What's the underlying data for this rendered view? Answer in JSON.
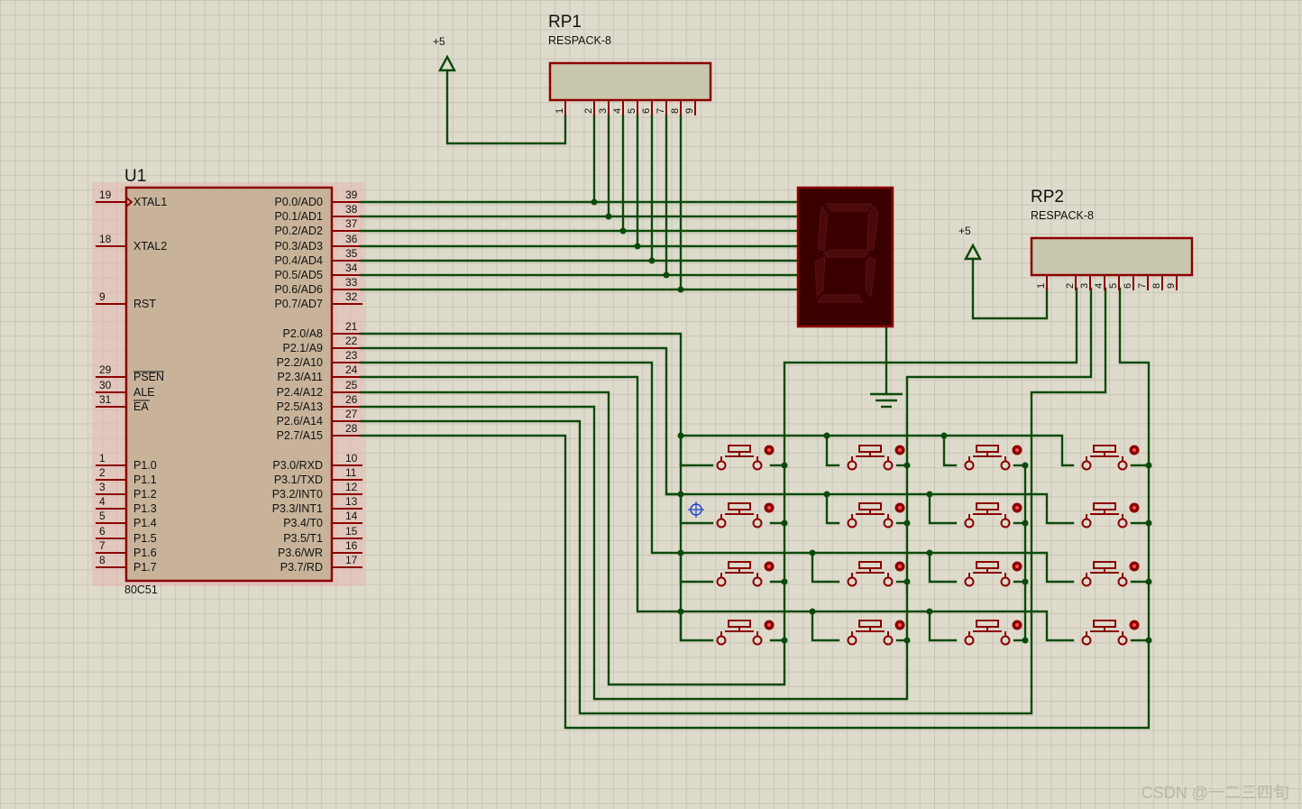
{
  "mcu": {
    "ref": "U1",
    "part": "80C51",
    "left_pins": [
      {
        "num": "19",
        "name": "XTAL1"
      },
      {
        "num": "18",
        "name": "XTAL2"
      },
      {
        "num": "9",
        "name": "RST"
      },
      {
        "num": "29",
        "name": "PSEN"
      },
      {
        "num": "30",
        "name": "ALE"
      },
      {
        "num": "31",
        "name": "EA"
      },
      {
        "num": "1",
        "name": "P1.0"
      },
      {
        "num": "2",
        "name": "P1.1"
      },
      {
        "num": "3",
        "name": "P1.2"
      },
      {
        "num": "4",
        "name": "P1.3"
      },
      {
        "num": "5",
        "name": "P1.4"
      },
      {
        "num": "6",
        "name": "P1.5"
      },
      {
        "num": "7",
        "name": "P1.6"
      },
      {
        "num": "8",
        "name": "P1.7"
      }
    ],
    "right_pins": [
      {
        "num": "39",
        "name": "P0.0/AD0"
      },
      {
        "num": "38",
        "name": "P0.1/AD1"
      },
      {
        "num": "37",
        "name": "P0.2/AD2"
      },
      {
        "num": "36",
        "name": "P0.3/AD3"
      },
      {
        "num": "35",
        "name": "P0.4/AD4"
      },
      {
        "num": "34",
        "name": "P0.5/AD5"
      },
      {
        "num": "33",
        "name": "P0.6/AD6"
      },
      {
        "num": "32",
        "name": "P0.7/AD7"
      },
      {
        "num": "21",
        "name": "P2.0/A8"
      },
      {
        "num": "22",
        "name": "P2.1/A9"
      },
      {
        "num": "23",
        "name": "P2.2/A10"
      },
      {
        "num": "24",
        "name": "P2.3/A11"
      },
      {
        "num": "25",
        "name": "P2.4/A12"
      },
      {
        "num": "26",
        "name": "P2.5/A13"
      },
      {
        "num": "27",
        "name": "P2.6/A14"
      },
      {
        "num": "28",
        "name": "P2.7/A15"
      },
      {
        "num": "10",
        "name": "P3.0/RXD"
      },
      {
        "num": "11",
        "name": "P3.1/TXD"
      },
      {
        "num": "12",
        "name": "P3.2/INT0"
      },
      {
        "num": "13",
        "name": "P3.3/INT1"
      },
      {
        "num": "14",
        "name": "P3.4/T0"
      },
      {
        "num": "15",
        "name": "P3.5/T1"
      },
      {
        "num": "16",
        "name": "P3.6/WR"
      },
      {
        "num": "17",
        "name": "P3.7/RD"
      }
    ]
  },
  "rp1": {
    "ref": "RP1",
    "value": "RESPACK-8",
    "power": "+5",
    "pins": [
      "1",
      "2",
      "3",
      "4",
      "5",
      "6",
      "7",
      "8",
      "9"
    ]
  },
  "rp2": {
    "ref": "RP2",
    "value": "RESPACK-8",
    "power": "+5",
    "pins": [
      "1",
      "2",
      "3",
      "4",
      "5",
      "6",
      "7",
      "8",
      "9"
    ]
  },
  "display": {
    "digit": "8",
    "segment_off_color": "#4a0a0a",
    "body_color": "#3a0000"
  },
  "keypad": {
    "rows": 4,
    "cols": 4
  },
  "colors": {
    "wire": "#0b4a0b",
    "component": "#8b0000",
    "chip_body": "#c8b39a",
    "resistor_body": "#c9c7ad"
  },
  "watermark": "CSDN @一二三四旬"
}
